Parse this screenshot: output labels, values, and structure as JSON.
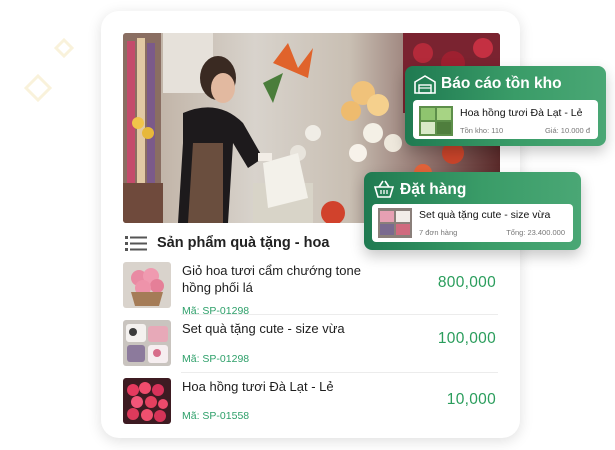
{
  "product_list": {
    "title": "Sản phẩm quà tặng - hoa",
    "items": [
      {
        "name": "Giỏ hoa tươi cẩm chướng tone hồng phối lá",
        "code": "Mã: SP-01298",
        "price": "800,000"
      },
      {
        "name": "Set quà tặng cute - size vừa",
        "code": "Mã: SP-01298",
        "price": "100,000"
      },
      {
        "name": "Hoa hồng tươi Đà Lạt - Lẻ",
        "code": "Mã: SP-01558",
        "price": "10,000"
      }
    ]
  },
  "inventory_card": {
    "title": "Báo cáo tồn kho",
    "item_name": "Hoa hồng tươi Đà Lạt - Lẻ",
    "stock": "Tồn kho: 110",
    "price": "Giá: 10.000 đ",
    "icon": "warehouse-icon"
  },
  "order_card": {
    "title": "Đặt hàng",
    "item_name": "Set quà tặng cute - size vừa",
    "orders": "7 đơn hàng",
    "total": "Tổng: 23.400.000",
    "icon": "basket-icon"
  },
  "colors": {
    "accent_green": "#2a9d5c",
    "card_gradient_start": "#1f7a51",
    "card_gradient_end": "#4aa775"
  }
}
